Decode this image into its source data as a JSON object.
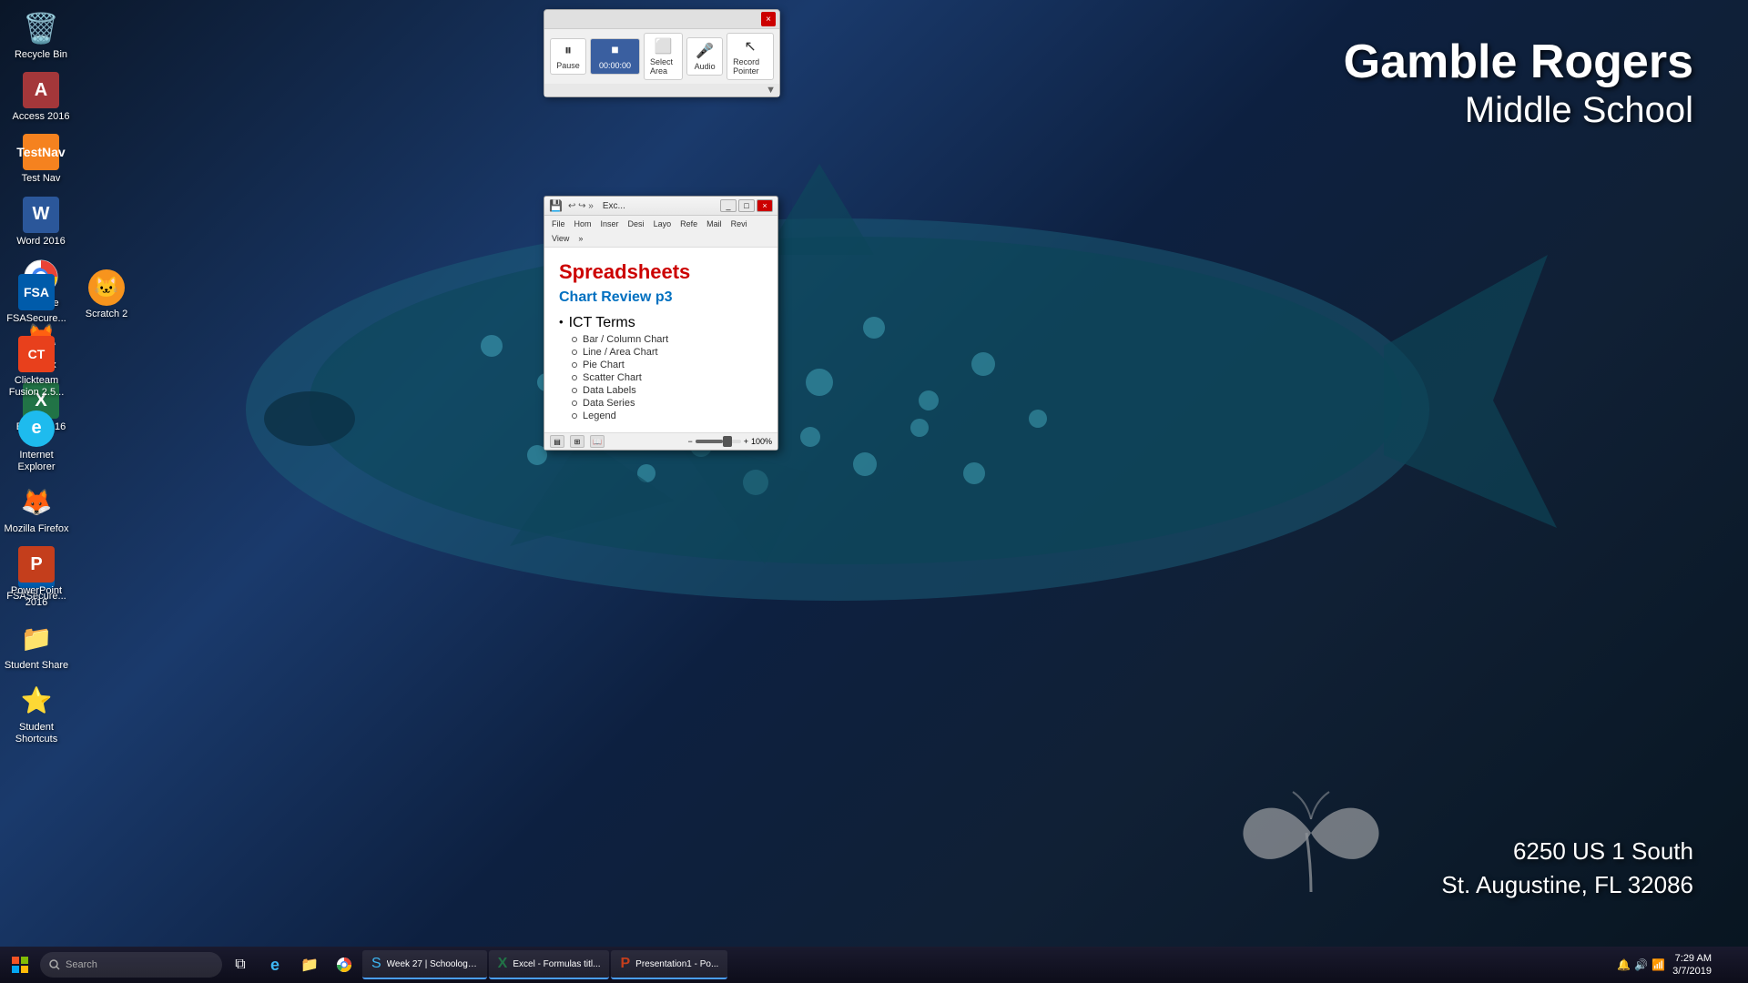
{
  "desktop": {
    "background_color": "#0a1628"
  },
  "school": {
    "name_line1": "Gamble Rogers",
    "name_line2": "Middle School",
    "address_line1": "6250 US 1 South",
    "address_line2": "St. Augustine, FL 32086"
  },
  "desktop_icons": [
    {
      "id": "recycle-bin",
      "label": "Recycle Bin",
      "icon": "🗑️",
      "color": "transparent"
    },
    {
      "id": "access-2016",
      "label": "Access 2016",
      "icon": "A",
      "color": "#a4373a"
    },
    {
      "id": "test-nav",
      "label": "Test Nav",
      "icon": "📋",
      "color": "#f5821f"
    },
    {
      "id": "word-2016",
      "label": "Word 2016",
      "icon": "W",
      "color": "#2b579a"
    },
    {
      "id": "chrome",
      "label": "Chrome",
      "icon": "◎",
      "color": "transparent"
    },
    {
      "id": "firefox",
      "label": "Firefox",
      "icon": "🦊",
      "color": "transparent"
    },
    {
      "id": "excel-2016",
      "label": "Excel 2016",
      "icon": "X",
      "color": "#217346"
    },
    {
      "id": "scratch-2",
      "label": "Scratch 2",
      "icon": "🐱",
      "color": "#f7941d"
    },
    {
      "id": "fsa-secure",
      "label": "FSASecure...",
      "icon": "F",
      "color": "#005baa"
    },
    {
      "id": "clickteam",
      "label": "Clickteam Fusion 2.5...",
      "icon": "C",
      "color": "#e8401c"
    },
    {
      "id": "internet-explorer",
      "label": "Internet Explorer",
      "icon": "e",
      "color": "#1ebbee"
    },
    {
      "id": "mozilla-firefox",
      "label": "Mozilla Firefox",
      "icon": "🦊",
      "color": "transparent"
    },
    {
      "id": "powerpoint",
      "label": "PowerPoint 2016",
      "icon": "P",
      "color": "#c43e1c"
    },
    {
      "id": "student-share",
      "label": "Student Share",
      "icon": "📁",
      "color": "#ffd700"
    },
    {
      "id": "student-shortcuts",
      "label": "Student Shortcuts",
      "icon": "⭐",
      "color": "#ffd700"
    }
  ],
  "toolbar_window": {
    "buttons": [
      {
        "id": "pause",
        "label": "Pause",
        "icon": "⏸"
      },
      {
        "id": "stop",
        "label": "00:00:00",
        "icon": "⏹"
      },
      {
        "id": "select-area",
        "label": "Select Area",
        "icon": "⬜"
      },
      {
        "id": "audio",
        "label": "Audio",
        "icon": "🎤"
      },
      {
        "id": "record-pointer",
        "label": "Record Pointer",
        "icon": "↖"
      }
    ],
    "close_label": "×"
  },
  "ppt_window": {
    "title_bar": "Exc...",
    "menu_items": [
      "File",
      "Hom",
      "Inser",
      "Desi",
      "Layo",
      "Refe",
      "Mail",
      "Revi",
      "View"
    ],
    "slide": {
      "title": "Spreadsheets",
      "subtitle": "Chart Review p3",
      "bullet_main": "ICT Terms",
      "sub_items": [
        "Bar / Column Chart",
        "Line / Area Chart",
        "Pie Chart",
        "Scatter Chart",
        "Data Labels",
        "Data Series",
        "Legend"
      ]
    },
    "statusbar": {
      "zoom": "100%"
    },
    "window_controls": {
      "minimize": "_",
      "maximize": "□",
      "close": "×"
    }
  },
  "taskbar": {
    "start_icon": "⊞",
    "search_placeholder": "Search",
    "apps": [
      {
        "id": "task-view",
        "label": "",
        "icon": "⧉"
      },
      {
        "id": "edge",
        "label": "",
        "icon": "e"
      },
      {
        "id": "file-explorer",
        "label": "",
        "icon": "📁"
      },
      {
        "id": "schoology",
        "label": "Week 27 | Schoology...",
        "icon": "S"
      },
      {
        "id": "excel-task",
        "label": "Excel - Formulas titl...",
        "icon": "X"
      },
      {
        "id": "ppt-task",
        "label": "Presentation1 - Po...",
        "icon": "P"
      }
    ],
    "time": "7:29 AM",
    "date": "3/7/2019"
  }
}
